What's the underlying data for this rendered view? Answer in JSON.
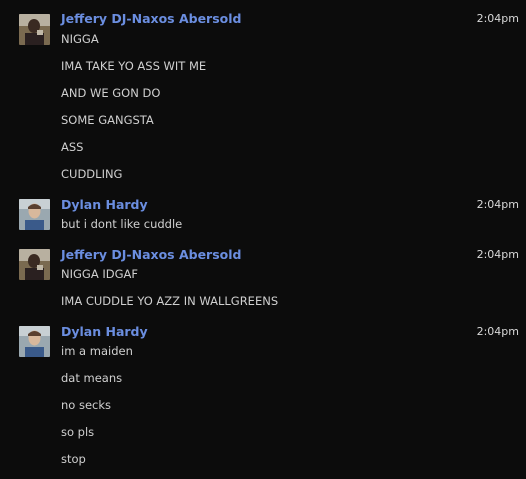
{
  "conversation": {
    "groups": [
      {
        "sender": "Jeffery DJ-Naxos Abersold",
        "avatar_icon": "user-photo-jeffery",
        "time": "2:04pm",
        "lines": [
          "NIGGA",
          "IMA TAKE YO ASS WIT ME",
          "AND WE GON DO",
          "SOME GANGSTA",
          "ASS",
          "CUDDLING"
        ]
      },
      {
        "sender": "Dylan Hardy",
        "avatar_icon": "user-photo-dylan",
        "time": "2:04pm",
        "lines": [
          "but i dont like cuddle"
        ]
      },
      {
        "sender": "Jeffery DJ-Naxos Abersold",
        "avatar_icon": "user-photo-jeffery",
        "time": "2:04pm",
        "lines": [
          "NIGGA IDGAF",
          "IMA CUDDLE YO AZZ IN WALLGREENS"
        ]
      },
      {
        "sender": "Dylan Hardy",
        "avatar_icon": "user-photo-dylan",
        "time": "2:04pm",
        "lines": [
          "im a maiden",
          "dat means",
          "no secks",
          "so pls",
          "stop"
        ]
      }
    ]
  },
  "colors": {
    "background": "#0c0c0c",
    "sender_name": "#6b8ee0",
    "message_text": "#d0d0d0",
    "timestamp": "#d8d8d8"
  }
}
